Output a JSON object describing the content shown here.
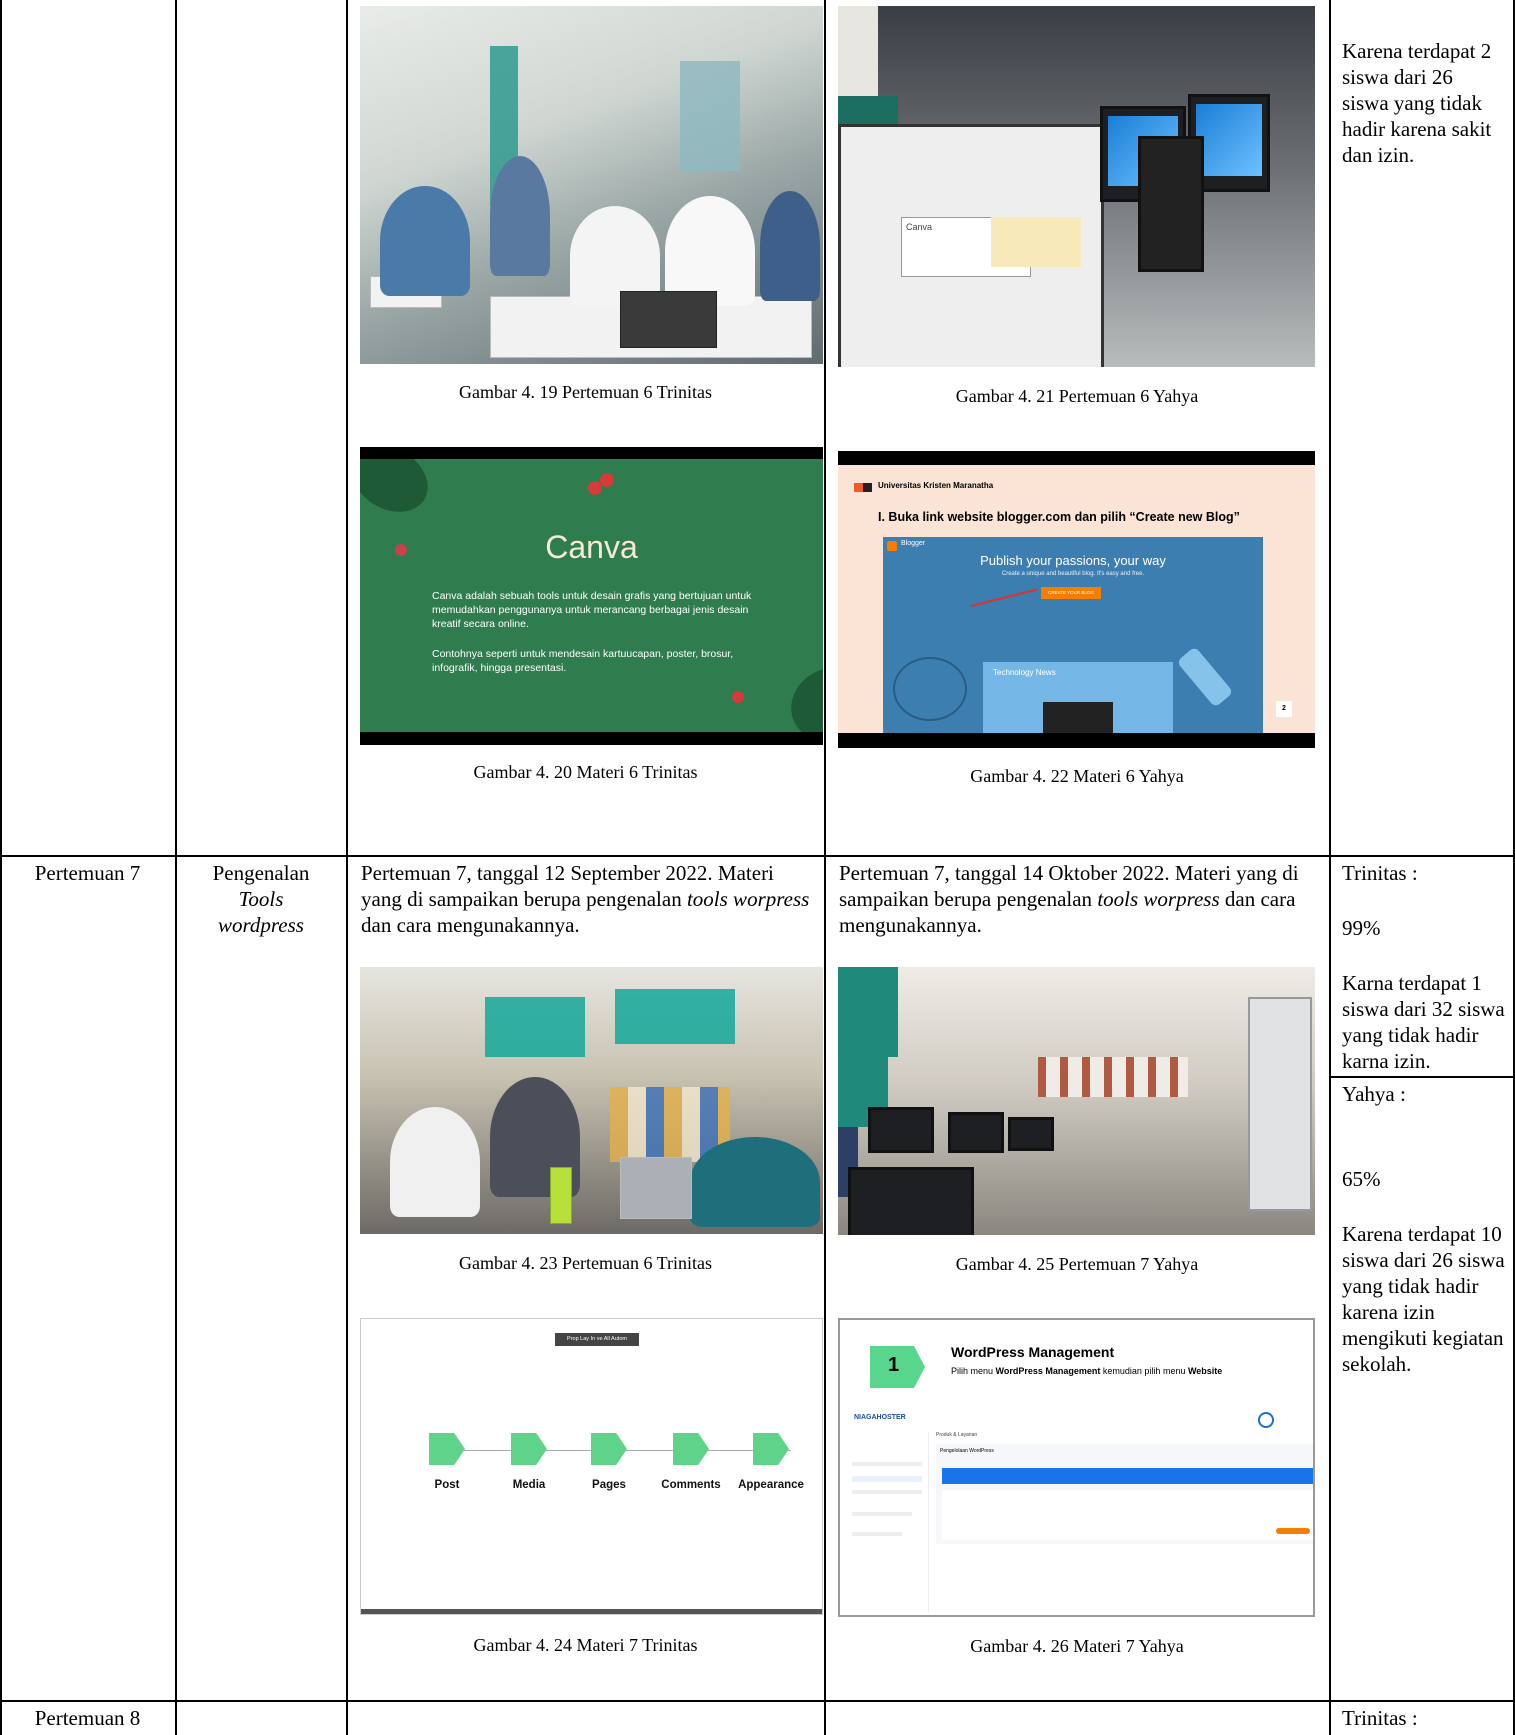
{
  "row1": {
    "trinitas_photo_caption": "Gambar 4. 19 Pertemuan 6 Trinitas",
    "trinitas_slide_caption": "Gambar 4. 20 Materi 6 Trinitas",
    "yahya_photo_caption": "Gambar 4. 21 Pertemuan 6 Yahya",
    "yahya_slide_caption": "Gambar 4. 22 Materi 6 Yahya",
    "note": "Karena terdapat 2 siswa dari 26 siswa yang tidak hadir karena sakit dan izin.",
    "canva_slide": {
      "title": "Canva",
      "para1": "Canva adalah sebuah tools untuk desain grafis yang bertujuan untuk memudahkan penggunanya untuk merancang berbagai jenis desain kreatif secara online.",
      "para2": "Contohnya seperti untuk mendesain kartuucapan, poster, brosur, infografik, hingga presentasi."
    },
    "blogger_slide": {
      "university": "Universitas Kristen Maranatha",
      "heading": "I.  Buka link website blogger.com dan pilih “Create new Blog”",
      "brand": "Blogger",
      "headline": "Publish your passions, your way",
      "subline": "Create a unique and beautiful blog. It's easy and free.",
      "button": "CREATE YOUR BLOG",
      "card_title": "Technology News",
      "page_number": "2"
    }
  },
  "row2": {
    "meeting": "Pertemuan 7",
    "topic_line1": "Pengenalan",
    "topic_line2": "Tools",
    "topic_line3": "wordpress",
    "trinitas_desc_1": "Pertemuan 7, tanggal 12 September 2022. Materi yang di sampaikan berupa pengenalan ",
    "trinitas_desc_em": "tools worpress",
    "trinitas_desc_2": " dan cara mengunakannya.",
    "yahya_desc_1": "Pertemuan 7, tanggal 14 Oktober 2022. Materi yang di sampaikan berupa pengenalan ",
    "yahya_desc_em": "tools worpress",
    "yahya_desc_2": " dan cara mengunakannya.",
    "trinitas_photo_caption": "Gambar 4. 23 Pertemuan 6 Trinitas",
    "trinitas_slide_caption": "Gambar 4. 24 Materi 7 Trinitas",
    "yahya_photo_caption": "Gambar 4. 25 Pertemuan 7 Yahya",
    "yahya_slide_caption": "Gambar 4. 26 Materi 7 Yahya",
    "trinitas_label": "Trinitas :",
    "trinitas_pct": "99%",
    "trinitas_note": "Karna terdapat 1 siswa dari 32 siswa yang tidak hadir karna izin.",
    "yahya_label": "Yahya :",
    "yahya_pct": "65%",
    "yahya_note": "Karena terdapat 10 siswa dari 26 siswa yang tidak hadir karena izin mengikuti kegiatan sekolah.",
    "wp_flow": {
      "toolbar": "Prop  Lay  In ve  All Autom",
      "steps": [
        "Post",
        "Media",
        "Pages",
        "Comments",
        "Appearance"
      ]
    },
    "wp_mgmt": {
      "step": "1",
      "title": "WordPress Management",
      "subtitle_1": "Pilih menu ",
      "subtitle_b1": "WordPress Management",
      "subtitle_2": " kemudian pilih menu ",
      "subtitle_b2": "Website",
      "brand": "NIAGAHOSTER",
      "crumb": "Produk & Layanan",
      "panel": "Pengelolaan WordPress"
    }
  },
  "row3": {
    "meeting": "Pertemuan 8",
    "trinitas_label": "Trinitas :"
  }
}
